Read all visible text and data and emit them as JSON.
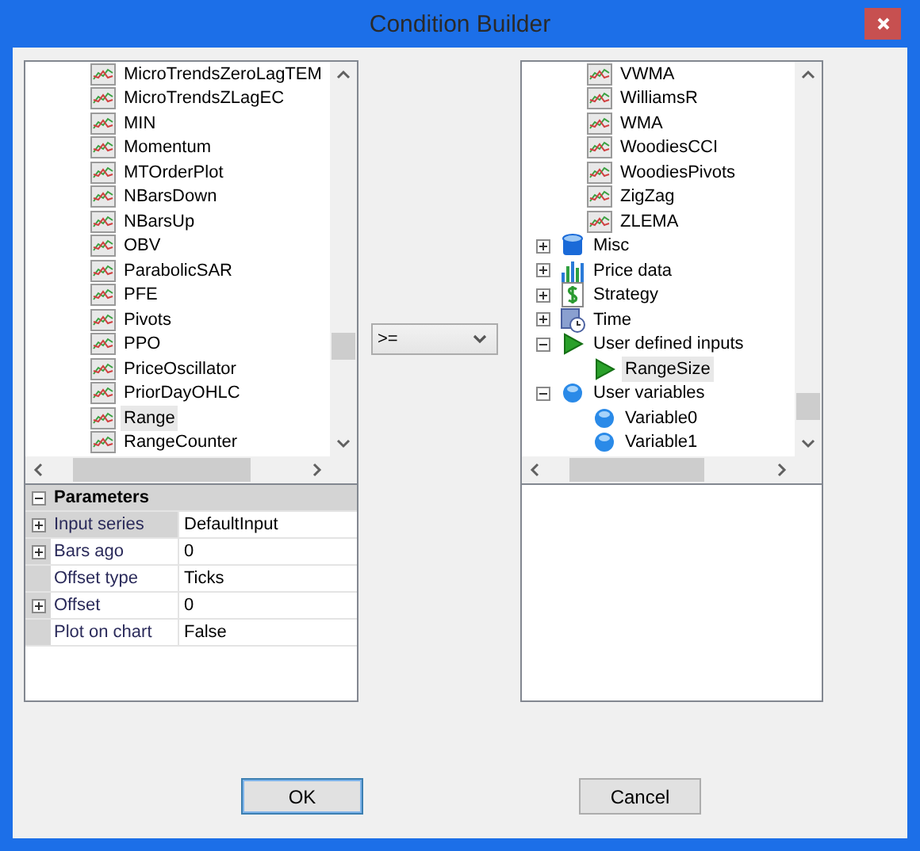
{
  "window": {
    "title": "Condition Builder"
  },
  "left_tree": {
    "items": [
      {
        "label": "MicroTrendsZeroLagTEM",
        "selected": false
      },
      {
        "label": "MicroTrendsZLagEC",
        "selected": false
      },
      {
        "label": "MIN",
        "selected": false
      },
      {
        "label": "Momentum",
        "selected": false
      },
      {
        "label": "MTOrderPlot",
        "selected": false
      },
      {
        "label": "NBarsDown",
        "selected": false
      },
      {
        "label": "NBarsUp",
        "selected": false
      },
      {
        "label": "OBV",
        "selected": false
      },
      {
        "label": "ParabolicSAR",
        "selected": false
      },
      {
        "label": "PFE",
        "selected": false
      },
      {
        "label": "Pivots",
        "selected": false
      },
      {
        "label": "PPO",
        "selected": false
      },
      {
        "label": "PriceOscillator",
        "selected": false
      },
      {
        "label": "PriorDayOHLC",
        "selected": false
      },
      {
        "label": "Range",
        "selected": true
      },
      {
        "label": "RangeCounter",
        "selected": false
      }
    ]
  },
  "parameters": {
    "title": "Parameters",
    "expanded": true,
    "rows": [
      {
        "name": "Input series",
        "value": "DefaultInput",
        "expandable": true,
        "selected": true
      },
      {
        "name": "Bars ago",
        "value": "0",
        "expandable": true,
        "selected": false
      },
      {
        "name": "Offset type",
        "value": "Ticks",
        "expandable": false,
        "selected": false
      },
      {
        "name": "Offset",
        "value": "0",
        "expandable": true,
        "selected": false
      },
      {
        "name": "Plot on chart",
        "value": "False",
        "expandable": false,
        "selected": false
      }
    ]
  },
  "operator": {
    "value": ">="
  },
  "right_tree": {
    "scrolled_group_children": [
      {
        "label": "VWMA",
        "kind": "indicator",
        "selected": false
      },
      {
        "label": "WilliamsR",
        "kind": "indicator",
        "selected": false
      },
      {
        "label": "WMA",
        "kind": "indicator",
        "selected": false
      },
      {
        "label": "WoodiesCCI",
        "kind": "indicator",
        "selected": false
      },
      {
        "label": "WoodiesPivots",
        "kind": "indicator",
        "selected": false
      },
      {
        "label": "ZigZag",
        "kind": "indicator",
        "selected": false
      },
      {
        "label": "ZLEMA",
        "kind": "indicator",
        "selected": false
      }
    ],
    "categories": [
      {
        "label": "Misc",
        "kind": "misc",
        "expanded": false
      },
      {
        "label": "Price data",
        "kind": "price",
        "expanded": false
      },
      {
        "label": "Strategy",
        "kind": "strategy",
        "expanded": false
      },
      {
        "label": "Time",
        "kind": "time",
        "expanded": false
      },
      {
        "label": "User defined inputs",
        "kind": "input",
        "expanded": true,
        "children": [
          {
            "label": "RangeSize",
            "kind": "input",
            "selected": true
          }
        ]
      },
      {
        "label": "User variables",
        "kind": "variable",
        "expanded": true,
        "children": [
          {
            "label": "Variable0",
            "kind": "variable",
            "selected": false
          },
          {
            "label": "Variable1",
            "kind": "variable",
            "selected": false
          }
        ]
      }
    ]
  },
  "buttons": [
    {
      "label": "OK",
      "kind": "default"
    },
    {
      "label": "Cancel",
      "kind": "normal"
    }
  ]
}
